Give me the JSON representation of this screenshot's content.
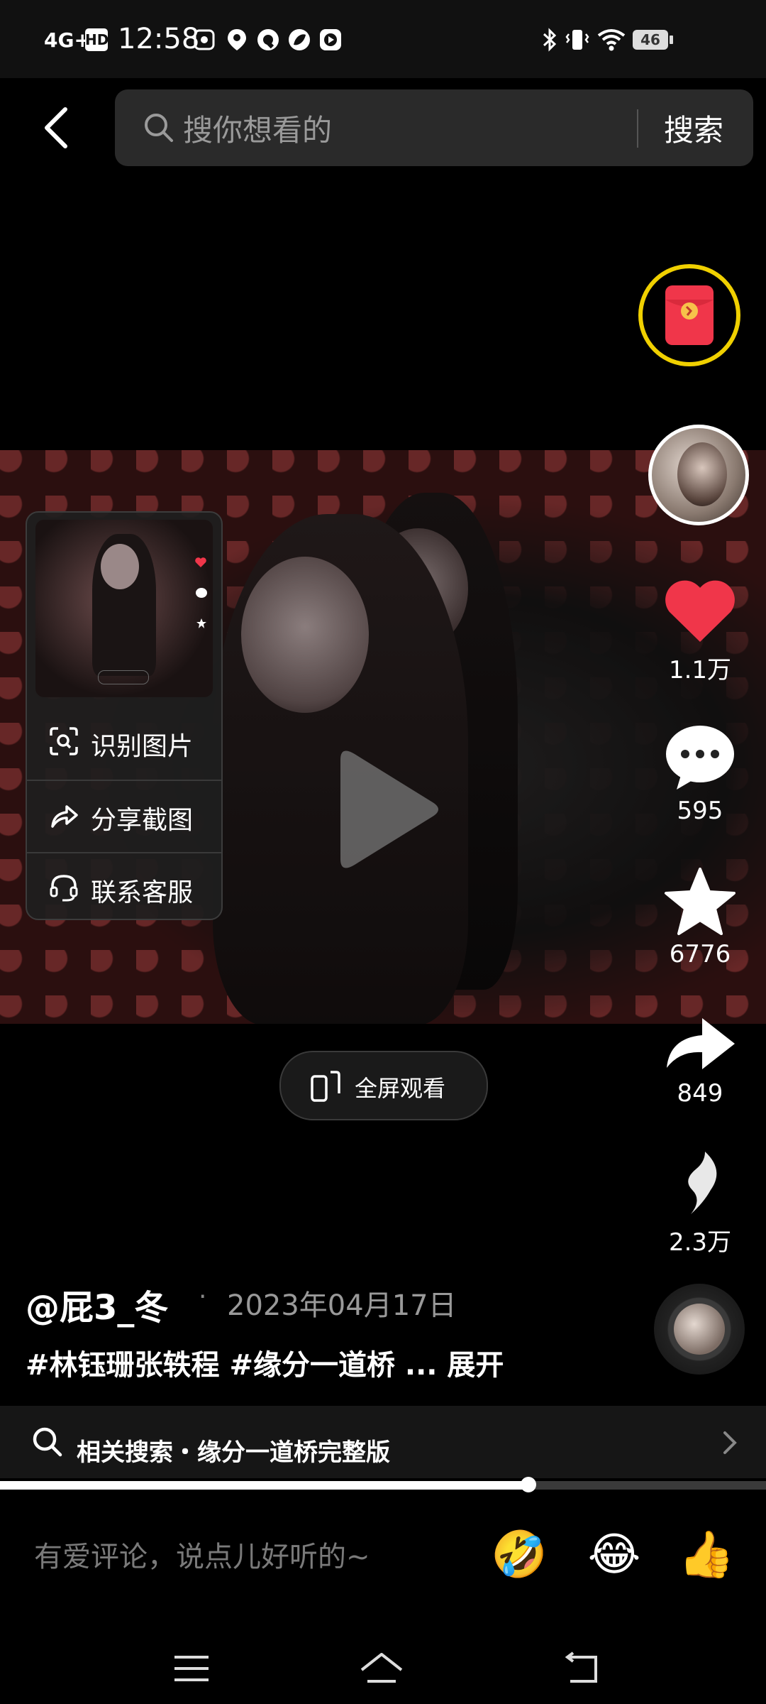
{
  "status_bar": {
    "network": "4G+",
    "hd": "HD",
    "time": "12:58",
    "battery": "46"
  },
  "search": {
    "placeholder": "搜你想看的",
    "button": "搜索"
  },
  "menu": {
    "items": [
      {
        "label": "识别图片",
        "icon": "scan-image-icon"
      },
      {
        "label": "分享截图",
        "icon": "share-arrow-icon"
      },
      {
        "label": "联系客服",
        "icon": "headset-icon"
      }
    ]
  },
  "rail": {
    "likes": "1.1万",
    "comments": "595",
    "favorites": "6776",
    "shares": "849",
    "extra": "2.3万"
  },
  "fullscreen_label": "全屏观看",
  "post": {
    "author": "@屁3_冬",
    "separator": "·",
    "date": "2023年04月17日",
    "caption": "#林钰珊张轶程 #缘分一道桥 ... 展开"
  },
  "related": {
    "label": "相关搜索・缘分一道桥完整版"
  },
  "progress": {
    "fraction": 0.69
  },
  "comment": {
    "placeholder": "有爱评论，说点儿好听的~",
    "emojis": [
      "🤣",
      "😂",
      "👍"
    ]
  },
  "colors": {
    "like_red": "#f0364a",
    "gold_ring": "#f0d000"
  }
}
